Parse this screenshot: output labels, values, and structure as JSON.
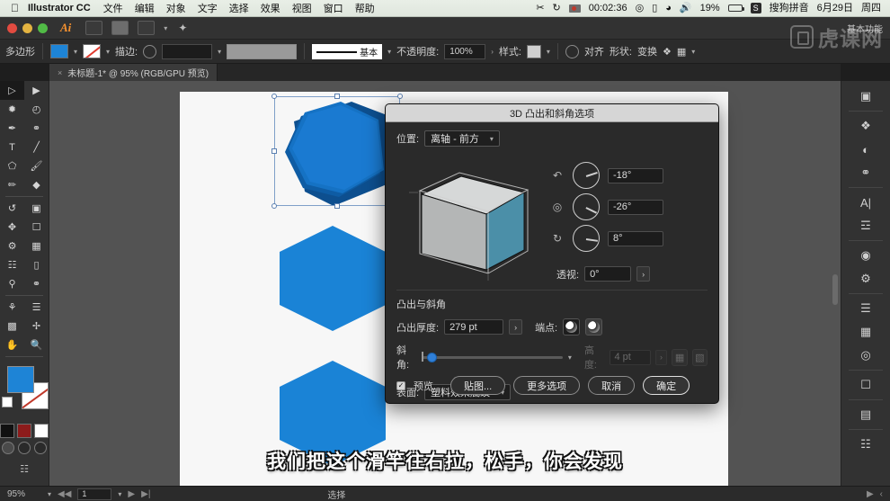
{
  "macbar": {
    "apple_icon": "apple-icon",
    "app_name": "Illustrator CC",
    "menus": [
      "文件",
      "编辑",
      "对象",
      "文字",
      "选择",
      "效果",
      "视图",
      "窗口",
      "帮助"
    ],
    "status_items": {
      "scissors_icon": "✂",
      "sync_icon": "↻",
      "rec_time": "00:02:36",
      "link_icon": "◎",
      "display_icon": "display-icon",
      "wifi_icon": "wifi-icon",
      "volume_icon": "🔊",
      "battery_percent": "19%",
      "battery_icon": "battery-charging-icon",
      "input_badge": "S",
      "input_method": "搜狗拼音",
      "date": "6月29日",
      "weekday": "周四"
    }
  },
  "appbar": {
    "ai_logo": "Ai",
    "right_label": "基本功能"
  },
  "controlbar": {
    "object_type": "多边形",
    "fill_label": "fill-swatch",
    "stroke_label": "stroke-swatch",
    "stroke_text": "描边:",
    "stroke_weight": "",
    "stroke_profile": "基本",
    "opacity_label": "不透明度:",
    "opacity_value": "100%",
    "style_label": "样式:",
    "align_label": "对齐",
    "shape_label": "形状:",
    "transform_label": "变换"
  },
  "tab": {
    "close_icon": "×",
    "title": "未标题-1* @ 95% (RGB/GPU 预览)"
  },
  "toolbox": {
    "tools": [
      "selection-tool",
      "direct-selection-tool",
      "magic-wand-tool",
      "lasso-tool",
      "pen-tool",
      "curvature-tool",
      "type-tool",
      "line-segment-tool",
      "shape-tool",
      "paintbrush-tool",
      "pencil-tool",
      "shaper-tool",
      "rotate-tool",
      "scale-tool",
      "width-tool",
      "free-transform-tool",
      "shape-builder-tool",
      "perspective-grid-tool",
      "mesh-tool",
      "gradient-tool",
      "eyedropper-tool",
      "blend-tool",
      "symbol-sprayer-tool",
      "column-graph-tool",
      "artboard-tool",
      "slice-tool",
      "hand-tool",
      "zoom-tool"
    ],
    "fill_color": "#1e84d6",
    "stroke_color": "#ffffff",
    "screen_mode": "screen-mode-icon"
  },
  "canvas": {
    "artboard_bg": "#f7f7f7",
    "shape_color": "#1e84d6",
    "shape_3d_color": "#1463ab",
    "shapes": [
      {
        "name": "hexagon-3d-extruded",
        "selected": true
      },
      {
        "name": "hexagon-flat-middle",
        "selected": false
      },
      {
        "name": "hexagon-flat-bottom",
        "selected": false
      }
    ]
  },
  "dialog": {
    "title": "3D 凸出和斜角选项",
    "position_label": "位置:",
    "position_value": "离轴 - 前方",
    "rotation": [
      {
        "axis": "x-rotation",
        "icon": "rotate-x-icon",
        "value": "-18°",
        "angle": -18
      },
      {
        "axis": "y-rotation",
        "icon": "rotate-y-icon",
        "value": "-26°",
        "angle": -26
      },
      {
        "axis": "z-rotation",
        "icon": "rotate-z-icon",
        "value": "8°",
        "angle": 8
      }
    ],
    "perspective_label": "透视:",
    "perspective_value": "0°",
    "section_title": "凸出与斜角",
    "extrude_depth_label": "凸出厚度:",
    "extrude_depth_value": "279 pt",
    "cap_label": "端点:",
    "bevel_label": "斜角:",
    "bevel_value": "",
    "height_label": "高度:",
    "height_value": "4 pt",
    "surface_label": "表面:",
    "surface_value": "塑料效果底纹",
    "preview_label": "预览",
    "preview_checked": true,
    "map_art_button": "贴图...",
    "more_options_button": "更多选项",
    "cancel_button": "取消",
    "ok_button": "确定"
  },
  "rightpanel": {
    "icons": [
      "layers-panel-icon",
      "libraries-panel-icon",
      "brushes-panel-icon",
      "symbols-panel-icon",
      "character-panel-icon",
      "paragraph-panel-icon",
      "appearance-panel-icon",
      "graphic-styles-panel-icon",
      "align-panel-icon",
      "transform-panel-icon",
      "pathfinder-panel-icon",
      "color-guide-panel-icon",
      "export-panel-icon",
      "artboards-panel-icon",
      "transparency-panel-icon"
    ]
  },
  "statusbar": {
    "zoom": "95%",
    "page_field": "1",
    "tool_status": "选择"
  },
  "subtitle": {
    "text": "我们把这个滑竿往右拉，松手，你会发现"
  },
  "watermark": {
    "text": "虎课网"
  }
}
